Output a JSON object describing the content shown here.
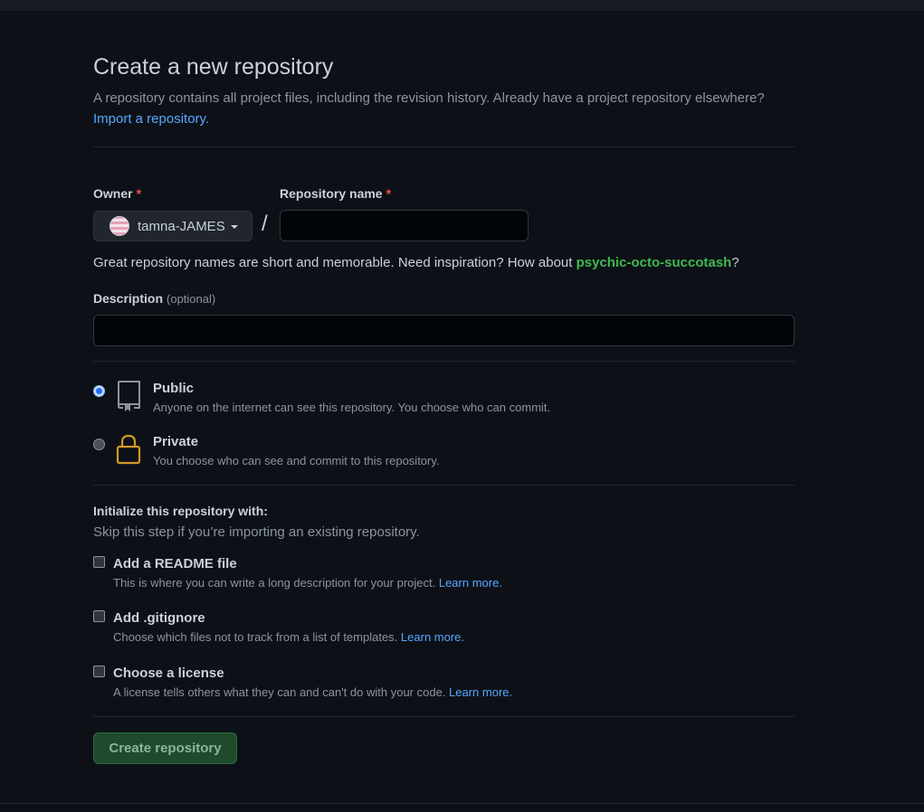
{
  "header": {
    "title": "Create a new repository",
    "subtitle": "A repository contains all project files, including the revision history. Already have a project repository elsewhere?",
    "import_link": "Import a repository."
  },
  "owner": {
    "label": "Owner",
    "required_mark": "*",
    "value": "tamna-JAMES"
  },
  "separator": "/",
  "repo_name": {
    "label": "Repository name",
    "required_mark": "*",
    "value": "",
    "hint_prefix": "Great repository names are short and memorable. Need inspiration? How about ",
    "suggestion": "psychic-octo-succotash",
    "hint_suffix": "?"
  },
  "description": {
    "label": "Description",
    "optional_label": "(optional)",
    "value": ""
  },
  "visibility": {
    "selected": "public",
    "options": [
      {
        "title": "Public",
        "description": "Anyone on the internet can see this repository. You choose who can commit.",
        "icon": "repo-icon"
      },
      {
        "title": "Private",
        "description": "You choose who can see and commit to this repository.",
        "icon": "lock-icon"
      }
    ]
  },
  "initialize": {
    "title": "Initialize this repository with:",
    "subtitle": "Skip this step if you’re importing an existing repository.",
    "options": [
      {
        "title": "Add a README file",
        "description": "This is where you can write a long description for your project. ",
        "link": "Learn more.",
        "checked": false
      },
      {
        "title": "Add .gitignore",
        "description": "Choose which files not to track from a list of templates. ",
        "link": "Learn more.",
        "checked": false
      },
      {
        "title": "Choose a license",
        "description": "A license tells others what they can and can't do with your code. ",
        "link": "Learn more.",
        "checked": false
      }
    ]
  },
  "submit": {
    "label": "Create repository"
  },
  "colors": {
    "background": "#0d1117",
    "link": "#58a6ff",
    "suggestion": "#3fb950",
    "required": "#f85149",
    "private_icon": "#d29922",
    "button_bg": "#1f4b2c"
  }
}
